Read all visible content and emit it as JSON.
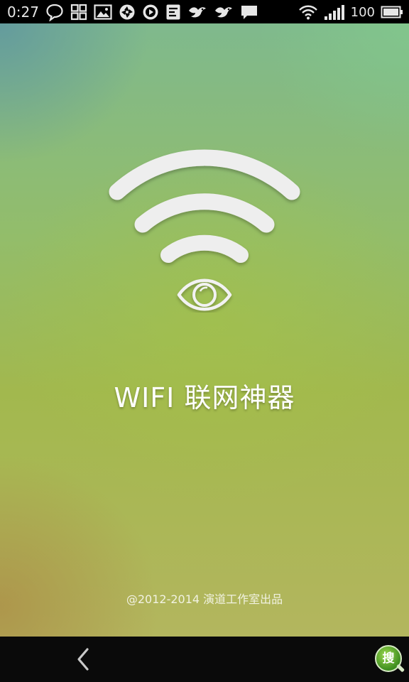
{
  "status_bar": {
    "time": "0:27",
    "battery_level": "100",
    "notification_icons": [
      "chat-bubble-icon",
      "grid-icon",
      "image-icon",
      "aperture-icon",
      "play-icon",
      "calendar-icon",
      "bird-icon",
      "bird-icon",
      "message-icon"
    ],
    "system_icons": [
      "wifi-icon",
      "signal-icon",
      "battery-icon"
    ]
  },
  "splash": {
    "logo_icon": "wifi-eye-logo-icon",
    "app_title": "WIFI 联网神器",
    "copyright": "@2012-2014 演道工作室出品"
  },
  "nav_bar": {
    "back_icon": "back-chevron-icon",
    "search_badge_label": "搜"
  },
  "colors": {
    "status_bar_bg": "#000000",
    "nav_bar_bg": "#0a0a0a",
    "logo_white": "#eeeeee",
    "badge_green": "#4a9a22"
  }
}
